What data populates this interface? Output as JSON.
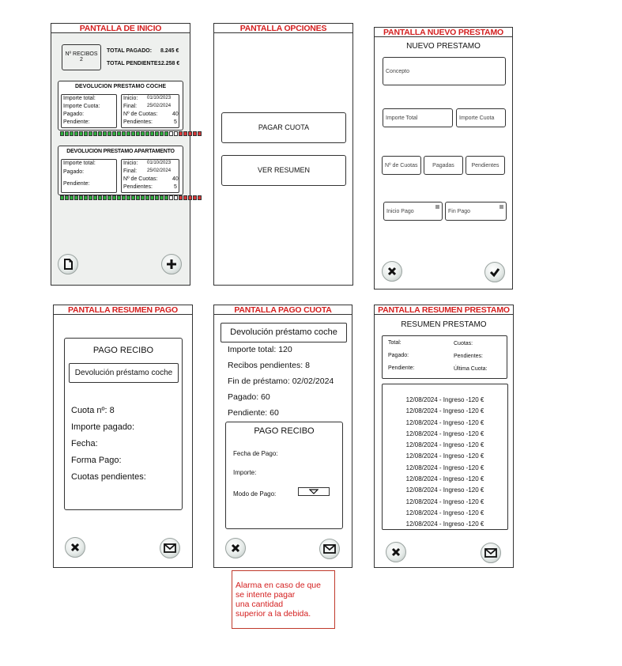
{
  "screens": {
    "inicio": {
      "title": "PANTALLA DE INICIO",
      "recibos_label": "Nº RECIBOS",
      "recibos_count": "2",
      "total_pagado_label": "TOTAL PAGADO:",
      "total_pagado_value": "8.245 €",
      "total_pendiente_label": "TOTAL PENDIENTE:",
      "total_pendiente_value": "12.258 €",
      "loan1": {
        "title": "DEVOLUCION PRESTAMO COCHE",
        "left": [
          "Importe total:",
          "Importe Cuota:",
          "Pagado:",
          "Pendiente:"
        ],
        "inicio_label": "Inicio:",
        "inicio_value": "01/10/2023",
        "final_label": "Final:",
        "final_value": "25/02/2024",
        "cuotas_label": "Nº de Cuotas:",
        "cuotas_value": "40",
        "pendientes_label": "Pendientes:",
        "pendientes_value": "5",
        "progress": "gggggggggggggggggggggggwwrrrrr"
      },
      "loan2": {
        "title": "DEVOLUCION PRESTAMO APARTAMENTO",
        "left": [
          "Importe total:",
          "Pagado:",
          "Pendiente:"
        ],
        "inicio_label": "Inicio:",
        "inicio_value": "01/10/2023",
        "final_label": "Final:",
        "final_value": "25/02/2024",
        "cuotas_label": "Nº de Cuotas:",
        "cuotas_value": "40",
        "pendientes_label": "Pendientes:",
        "pendientes_value": "5",
        "progress": "gggggggggggggggggggggggwwrrrrr"
      }
    },
    "opciones": {
      "title": "PANTALLA OPCIONES",
      "pagar_cuota": "PAGAR CUOTA",
      "ver_resumen": "VER RESUMEN"
    },
    "nuevo": {
      "title": "PANTALLA NUEVO PRESTAMO",
      "header": "NUEVO PRESTAMO",
      "concepto": "Concepto",
      "importe_total": "Importe Total",
      "importe_cuota": "Importe Cuota",
      "num_cuotas": "Nº de Cuotas",
      "pagadas": "Pagadas",
      "pendientes": "Pendientes",
      "inicio_pago": "Inicio Pago",
      "fin_pago": "Fin Pago"
    },
    "resumen_pago": {
      "title": "PANTALLA RESUMEN PAGO",
      "box_title": "PAGO RECIBO",
      "concept": "Devolución préstamo coche",
      "lines": [
        "Cuota nº: 8",
        "Importe pagado:",
        "Fecha:",
        "Forma Pago:",
        "Cuotas pendientes:"
      ]
    },
    "pago_cuota": {
      "title": "PANTALLA PAGO CUOTA",
      "concept": "Devolución préstamo coche",
      "lines": [
        "Importe total: 120",
        "Recibos pendientes: 8",
        "Fin de préstamo: 02/02/2024",
        "Pagado: 60",
        "Pendiente: 60"
      ],
      "box_title": "PAGO RECIBO",
      "fecha_label": "Fecha de Pago:",
      "importe_label": "Importe:",
      "modo_label": "Modo de Pago:",
      "alarm": [
        "Alarma en caso de que",
        "se intente pagar",
        "una cantidad",
        "superior a la debida."
      ]
    },
    "resumen_prestamo": {
      "title": "PANTALLA RESUMEN PRESTAMO",
      "header": "RESUMEN PRESTAMO",
      "total": "Total:",
      "cuotas": "Cuotas:",
      "pagado": "Pagado:",
      "pendientes": "Pendientes:",
      "pendiente": "Pendiente:",
      "ultima_cuota": "Última Cuota:",
      "entries": [
        "12/08/2024 - Ingreso -120 €",
        "12/08/2024 - Ingreso -120 €",
        "12/08/2024 - Ingreso -120 €",
        "12/08/2024 - Ingreso -120 €",
        "12/08/2024 - Ingreso -120 €",
        "12/08/2024 - Ingreso -120 €",
        "12/08/2024 - Ingreso -120 €",
        "12/08/2024 - Ingreso -120 €",
        "12/08/2024 - Ingreso -120 €",
        "12/08/2024 - Ingreso -120 €",
        "12/08/2024 - Ingreso -120 €",
        "12/08/2024 - Ingreso -120 €"
      ]
    }
  },
  "colors": {
    "title_red": "#d42020",
    "progress_green": "#2fae3e",
    "progress_red": "#d93a3a"
  },
  "icons": [
    "document-icon",
    "plus-icon",
    "close-icon",
    "check-icon",
    "mail-icon",
    "dropdown-icon"
  ]
}
